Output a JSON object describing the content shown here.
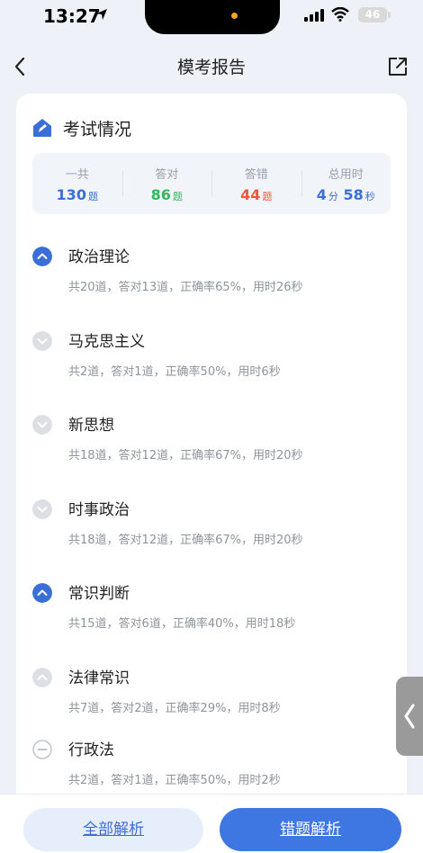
{
  "status_bar": {
    "time": "13:27",
    "battery": "46"
  },
  "header": {
    "title": "模考报告"
  },
  "section": {
    "title": "考试情况"
  },
  "summary": {
    "total": {
      "label": "一共",
      "value": "130",
      "unit": "题"
    },
    "correct": {
      "label": "答对",
      "value": "86",
      "unit": "题"
    },
    "wrong": {
      "label": "答错",
      "value": "44",
      "unit": "题"
    },
    "time": {
      "label": "总用时",
      "min_value": "4",
      "min_unit": "分",
      "sec_value": "58",
      "sec_unit": "秒"
    }
  },
  "subjects": [
    {
      "name": "政治理论",
      "detail": "共20道，答对13道，正确率65%，用时26秒",
      "state": "expanded"
    },
    {
      "name": "马克思主义",
      "detail": "共2道，答对1道，正确率50%，用时6秒",
      "state": "collapsed"
    },
    {
      "name": "新思想",
      "detail": "共18道，答对12道，正确率67%，用时20秒",
      "state": "collapsed"
    },
    {
      "name": "时事政治",
      "detail": "共18道，答对12道，正确率67%，用时20秒",
      "state": "collapsed"
    },
    {
      "name": "常识判断",
      "detail": "共15道，答对6道，正确率40%，用时18秒",
      "state": "expanded"
    },
    {
      "name": "法律常识",
      "detail": "共7道，答对2道，正确率29%，用时8秒",
      "state": "collapsed-up"
    },
    {
      "name": "行政法",
      "detail": "共2道，答对1道，正确率50%，用时2秒",
      "state": "minus"
    }
  ],
  "buttons": {
    "all_analysis": "全部解析",
    "wrong_analysis": "错题解析"
  },
  "colors": {
    "accent": "#3e76e2",
    "correct": "#35b85a",
    "wrong": "#ee5a3d",
    "background": "#eef1f7"
  }
}
